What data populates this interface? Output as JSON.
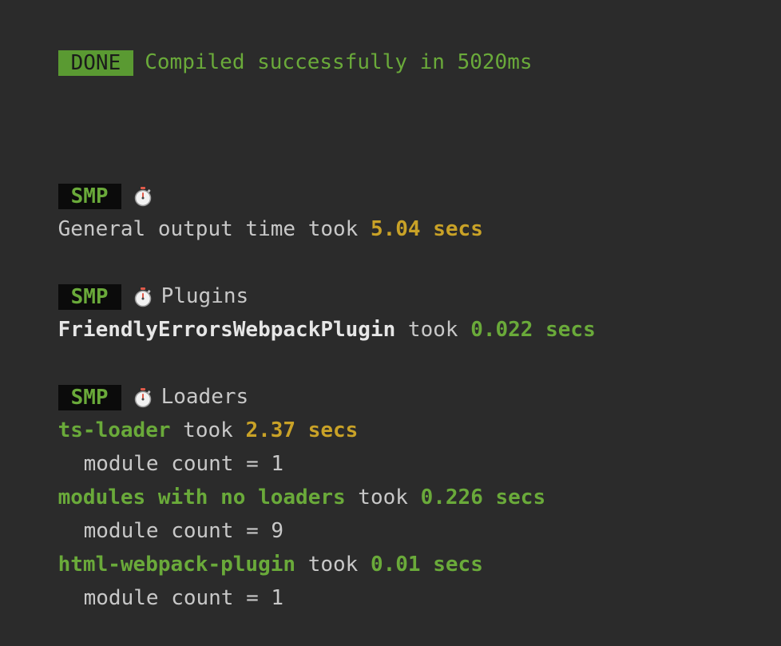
{
  "done": {
    "badge": "DONE",
    "message": "Compiled successfully in 5020ms"
  },
  "general": {
    "badge": "SMP",
    "icon": "stopwatch-icon",
    "label": "General output time took ",
    "time": "5.04 secs"
  },
  "plugins": {
    "badge": "SMP",
    "icon": "stopwatch-icon",
    "title": "Plugins",
    "items": [
      {
        "name": "FriendlyErrorsWebpackPlugin",
        "took": " took ",
        "time": "0.022 secs"
      }
    ]
  },
  "loaders": {
    "badge": "SMP",
    "icon": "stopwatch-icon",
    "title": "Loaders",
    "items": [
      {
        "name": "ts-loader",
        "took": " took ",
        "time": "2.37 secs",
        "count": "module count = 1"
      },
      {
        "name": "modules with no loaders",
        "took": " took ",
        "time": "0.226 secs",
        "count": "module count = 9"
      },
      {
        "name": "html-webpack-plugin",
        "took": " took ",
        "time": "0.01 secs",
        "count": "module count = 1"
      }
    ]
  },
  "colors": {
    "background": "#2b2b2b",
    "green": "#6aaa3a",
    "yellow": "#c9a227",
    "done_badge": "#5a9a32",
    "smp_badge": "#0b0b0b"
  }
}
